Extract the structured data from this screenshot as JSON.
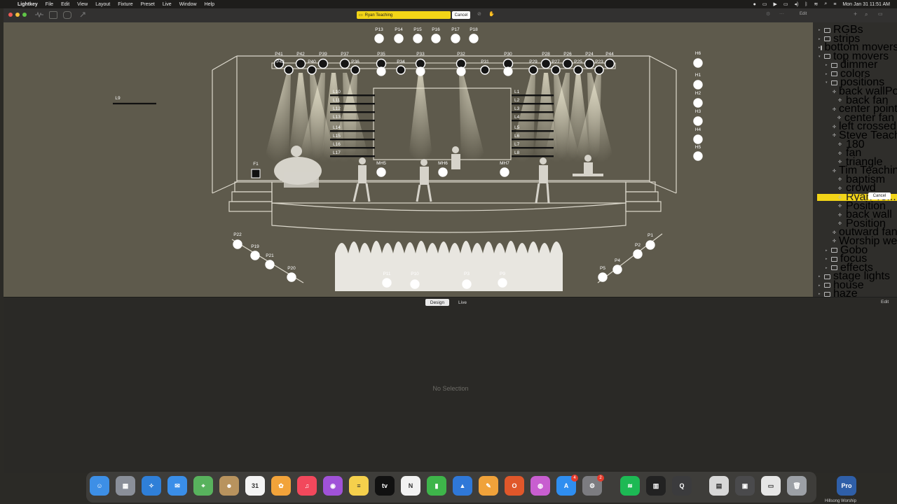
{
  "menubar": {
    "app_name": "Lightkey",
    "menus": [
      "File",
      "Edit",
      "View",
      "Layout",
      "Fixture",
      "Preset",
      "Live",
      "Window",
      "Help"
    ],
    "datetime": "Mon Jan 31  11:51 AM"
  },
  "toolbar": {
    "cue_name": "Ryan Teaching",
    "cancel_label": "Cancel",
    "edit_label": "Edit"
  },
  "stage": {
    "fixtures": {
      "p_top": [
        "P13",
        "P14",
        "P15",
        "P16",
        "P17",
        "P18"
      ],
      "p_truss": [
        "P41",
        "P42",
        "P39",
        "P37",
        "P35",
        "P33",
        "P32",
        "P30",
        "P28",
        "P26",
        "P24",
        "P44"
      ],
      "p_truss_low": [
        "P43",
        "P40",
        "P36",
        "P34",
        "P31",
        "P29",
        "P27",
        "P25",
        "P23"
      ],
      "h": [
        "H6",
        "H1",
        "H2",
        "H3",
        "H4",
        "H5"
      ],
      "l_left": [
        "L10",
        "L11",
        "L12",
        "L13",
        "L14",
        "L15",
        "L16",
        "L17"
      ],
      "l_right": [
        "L1",
        "L2",
        "L3",
        "L4",
        "L5",
        "L6",
        "L7",
        "L8"
      ],
      "l_far": "L9",
      "f": "F1",
      "mh": [
        "MH5",
        "MH6",
        "MH7"
      ],
      "floor_left": [
        "P22",
        "P19",
        "P21",
        "P20"
      ],
      "floor_right": [
        "P1",
        "P2",
        "P4",
        "P5"
      ],
      "front": [
        "P11",
        "P10",
        "P3",
        "P9"
      ]
    }
  },
  "sidebar": {
    "items": [
      {
        "label": "RGBs",
        "level": 0,
        "type": "folder",
        "open": false
      },
      {
        "label": "strips",
        "level": 0,
        "type": "folder",
        "open": false
      },
      {
        "label": "bottom movers",
        "level": 0,
        "type": "folder",
        "open": false
      },
      {
        "label": "top movers",
        "level": 0,
        "type": "folder",
        "open": true
      },
      {
        "label": "dimmer",
        "level": 1,
        "type": "folder",
        "open": false
      },
      {
        "label": "colors",
        "level": 1,
        "type": "folder",
        "open": false
      },
      {
        "label": "positions",
        "level": 1,
        "type": "folder",
        "open": true
      },
      {
        "label": "back wallPosition",
        "level": 2,
        "type": "cue"
      },
      {
        "label": "back fan",
        "level": 2,
        "type": "cue"
      },
      {
        "label": "center point",
        "level": 2,
        "type": "cue"
      },
      {
        "label": "center fan",
        "level": 2,
        "type": "cue"
      },
      {
        "label": "left crossed",
        "level": 2,
        "type": "cue"
      },
      {
        "label": "Steve Teaching",
        "level": 2,
        "type": "cue"
      },
      {
        "label": "180",
        "level": 2,
        "type": "cue"
      },
      {
        "label": "fan",
        "level": 2,
        "type": "cue"
      },
      {
        "label": "triangle",
        "level": 2,
        "type": "cue"
      },
      {
        "label": "Tim Teaching",
        "level": 2,
        "type": "cue"
      },
      {
        "label": "baptism",
        "level": 2,
        "type": "cue"
      },
      {
        "label": "crowd",
        "level": 2,
        "type": "cue"
      },
      {
        "label": "Ryan Te...",
        "level": 2,
        "type": "cue",
        "selected": true
      },
      {
        "label": "Position",
        "level": 2,
        "type": "cue"
      },
      {
        "label": "back wall",
        "level": 2,
        "type": "cue"
      },
      {
        "label": "Position",
        "level": 2,
        "type": "cue"
      },
      {
        "label": "outward fan",
        "level": 2,
        "type": "cue"
      },
      {
        "label": "Worship welcome",
        "level": 2,
        "type": "cue"
      },
      {
        "label": "Gobo",
        "level": 1,
        "type": "folder",
        "open": false
      },
      {
        "label": "focus",
        "level": 1,
        "type": "folder",
        "open": false
      },
      {
        "label": "effects",
        "level": 1,
        "type": "folder",
        "open": false
      },
      {
        "label": "stage lights",
        "level": 0,
        "type": "folder",
        "open": false
      },
      {
        "label": "house",
        "level": 0,
        "type": "folder",
        "open": false
      },
      {
        "label": "haze",
        "level": 0,
        "type": "folder",
        "open": false
      }
    ],
    "cancel_label": "Cancel"
  },
  "bottom": {
    "design_label": "Design",
    "live_label": "Live",
    "no_selection": "No Selection",
    "edit_label": "Edit"
  },
  "dock": {
    "apps": [
      {
        "name": "Finder",
        "glyph": "☺",
        "color": "#3d8fe6"
      },
      {
        "name": "Launchpad",
        "glyph": "▦",
        "color": "#8a8f99"
      },
      {
        "name": "Safari",
        "glyph": "✧",
        "color": "#2f7fd8"
      },
      {
        "name": "Mail",
        "glyph": "✉",
        "color": "#3a8ee8"
      },
      {
        "name": "Maps",
        "glyph": "⌖",
        "color": "#58b25d"
      },
      {
        "name": "Contacts",
        "glyph": "☻",
        "color": "#b8935e"
      },
      {
        "name": "Calendar",
        "glyph": "31",
        "color": "#f4f4f4"
      },
      {
        "name": "Photos",
        "glyph": "✿",
        "color": "#f2a33a"
      },
      {
        "name": "Music",
        "glyph": "♫",
        "color": "#f2485c"
      },
      {
        "name": "Podcasts",
        "glyph": "◉",
        "color": "#a052d8"
      },
      {
        "name": "Notes",
        "glyph": "≡",
        "color": "#f5d04c"
      },
      {
        "name": "TV",
        "glyph": "tv",
        "color": "#111111"
      },
      {
        "name": "News",
        "glyph": "N",
        "color": "#f2f2f2"
      },
      {
        "name": "Numbers",
        "glyph": "▮",
        "color": "#3eb54a"
      },
      {
        "name": "Keynote",
        "glyph": "▲",
        "color": "#2f78d8"
      },
      {
        "name": "Pages",
        "glyph": "✎",
        "color": "#f0a23a"
      },
      {
        "name": "Office",
        "glyph": "O",
        "color": "#e0572a"
      },
      {
        "name": "Lightkey",
        "glyph": "◍",
        "color": "#c85ed0"
      },
      {
        "name": "App Store",
        "glyph": "A",
        "color": "#2f8ef0"
      },
      {
        "name": "System Preferences",
        "glyph": "⚙",
        "color": "#7c7c80"
      },
      {
        "name": "Spotify",
        "glyph": "≋",
        "color": "#1db954"
      },
      {
        "name": "Piano",
        "glyph": "▥",
        "color": "#222222"
      },
      {
        "name": "QuickTime",
        "glyph": "Q",
        "color": "#3b3b3d"
      },
      {
        "name": "Documents",
        "glyph": "▤",
        "color": "#d8d8d8"
      },
      {
        "name": "Screenshot",
        "glyph": "▣",
        "color": "#4a4a4c"
      },
      {
        "name": "Keyboard",
        "glyph": "▭",
        "color": "#e6e6e6"
      },
      {
        "name": "Trash",
        "glyph": "🗑",
        "color": "#9ca0a6"
      },
      {
        "name": "ProPresenter",
        "glyph": "Pro",
        "color": "#2f5fa8"
      }
    ],
    "badges": {
      "app_store": "4",
      "system_preferences": "2"
    },
    "caption": "Hillsong Worship"
  }
}
